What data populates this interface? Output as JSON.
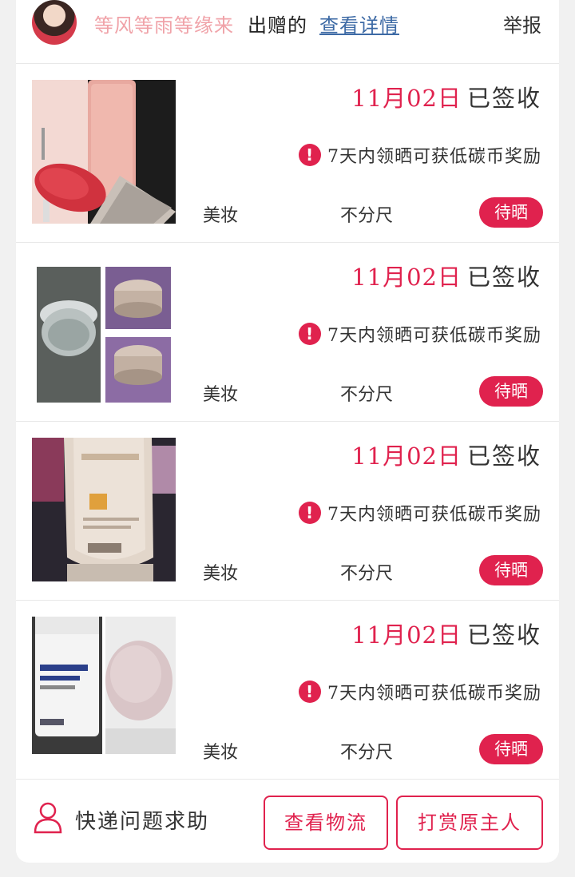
{
  "header": {
    "giver_name": "等风等雨等缘来",
    "gift_label": "出赠的",
    "detail_link": "查看详情",
    "report": "举报"
  },
  "items": [
    {
      "date": "11月02日",
      "status": "已签收",
      "notice": "7天内领晒可获低碳币奖励",
      "category": "美妆",
      "size": "不分尺",
      "button": "待晒"
    },
    {
      "date": "11月02日",
      "status": "已签收",
      "notice": "7天内领晒可获低碳币奖励",
      "category": "美妆",
      "size": "不分尺",
      "button": "待晒"
    },
    {
      "date": "11月02日",
      "status": "已签收",
      "notice": "7天内领晒可获低碳币奖励",
      "category": "美妆",
      "size": "不分尺",
      "button": "待晒"
    },
    {
      "date": "11月02日",
      "status": "已签收",
      "notice": "7天内领晒可获低碳币奖励",
      "category": "美妆",
      "size": "不分尺",
      "button": "待晒"
    }
  ],
  "footer": {
    "help_text": "快递问题求助",
    "logistics_button": "查看物流",
    "tip_button": "打赏原主人"
  },
  "icons": {
    "alert": "exclamation-circle-icon",
    "help": "person-outline-icon"
  },
  "colors": {
    "accent": "#e0224e",
    "giver_name": "#f0a2a8",
    "link": "#3d6aa5"
  }
}
